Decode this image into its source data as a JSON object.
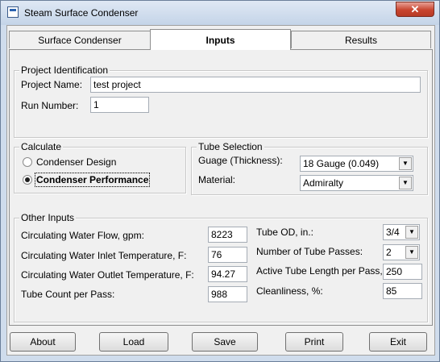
{
  "window": {
    "title": "Steam Surface Condenser",
    "close_glyph": "✕"
  },
  "tabs": [
    {
      "label": "Surface Condenser"
    },
    {
      "label": "Inputs",
      "active": true
    },
    {
      "label": "Results"
    }
  ],
  "project": {
    "group_label": "Project Identification",
    "name_label": "Project Name:",
    "name_value": "test project",
    "run_label": "Run Number:",
    "run_value": "1"
  },
  "calculate": {
    "group_label": "Calculate",
    "options": [
      {
        "label": "Condenser Design",
        "selected": false
      },
      {
        "label": "Condenser Performance",
        "selected": true
      }
    ]
  },
  "tube_selection": {
    "group_label": "Tube Selection",
    "gauge_label": "Guage (Thickness):",
    "gauge_value": "18 Gauge (0.049)",
    "material_label": "Material:",
    "material_value": "Admiralty",
    "arrow_glyph": "▼"
  },
  "other_inputs": {
    "group_label": "Other Inputs",
    "flow_label": "Circulating Water Flow, gpm:",
    "flow_value": "8223",
    "inlet_label": "Circulating Water Inlet Temperature, F:",
    "inlet_value": "76",
    "outlet_label": "Circulating Water Outlet Temperature, F:",
    "outlet_value": "94.27",
    "tube_count_label": "Tube Count per Pass:",
    "tube_count_value": "988",
    "tube_od_label": "Tube OD, in.:",
    "tube_od_value": "3/4",
    "passes_label": "Number of Tube Passes:",
    "passes_value": "2",
    "length_label": "Active Tube Length per Pass, in.",
    "length_value": "250",
    "cleanliness_label": "Cleanliness, %:",
    "cleanliness_value": "85"
  },
  "buttons": {
    "about": "About",
    "load": "Load",
    "save": "Save",
    "print": "Print",
    "exit": "Exit"
  }
}
